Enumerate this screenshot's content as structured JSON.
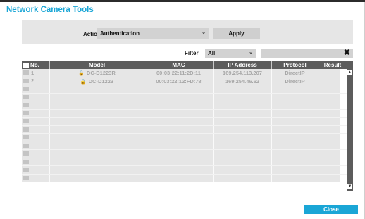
{
  "window": {
    "title": "Network Camera Tools"
  },
  "action": {
    "label": "Action",
    "selected": "Authentication",
    "apply_label": "Apply"
  },
  "filter": {
    "label": "Filter",
    "selected": "All",
    "search_value": "",
    "clear_icon": "✖"
  },
  "table": {
    "columns": [
      "No.",
      "Model",
      "MAC",
      "IP Address",
      "Protocol",
      "Result"
    ],
    "rows": [
      {
        "no": "1",
        "model": "DC-D1223R",
        "mac": "00:03:22:11:2D:11",
        "ip": "169.254.113.207",
        "protocol": "DirectIP",
        "result": ""
      },
      {
        "no": "2",
        "model": "DC-D1223",
        "mac": "00:03:22:12:FD:78",
        "ip": "169.254.46.62",
        "protocol": "DirectIP",
        "result": ""
      }
    ],
    "empty_rows": 12
  },
  "icons": {
    "caret": "⌄",
    "lock": "🔒",
    "scroll_up": "▲",
    "scroll_down": "▼"
  },
  "footer": {
    "close_label": "Close"
  },
  "colors": {
    "accent": "#1aa6d6",
    "header": "#5c5c5c"
  }
}
